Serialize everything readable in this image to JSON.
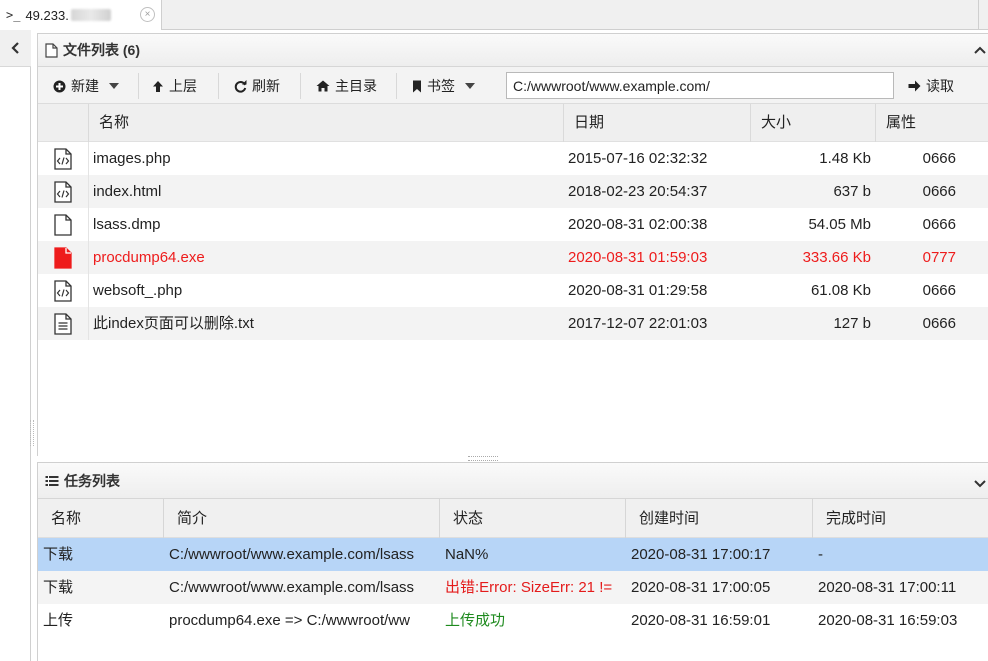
{
  "tab": {
    "prompt": ">_",
    "title": "49.233.",
    "close": "×"
  },
  "file_panel": {
    "title": "文件列表 (6)",
    "toolbar": {
      "new_label": "新建",
      "up_label": "上层",
      "refresh_label": "刷新",
      "home_label": "主目录",
      "bookmark_label": "书签",
      "path_value": "C:/wwwroot/www.example.com/",
      "read_label": "读取"
    },
    "columns": [
      "名称",
      "日期",
      "大小",
      "属性"
    ],
    "files": [
      {
        "icon": "code-file-icon",
        "name": "images.php",
        "date": "2015-07-16 02:32:32",
        "size": "1.48 Kb",
        "attr": "0666"
      },
      {
        "icon": "code-file-icon",
        "name": "index.html",
        "date": "2018-02-23 20:54:37",
        "size": "637 b",
        "attr": "0666"
      },
      {
        "icon": "blank-file-icon",
        "name": "lsass.dmp",
        "date": "2020-08-31 02:00:38",
        "size": "54.05 Mb",
        "attr": "0666"
      },
      {
        "icon": "executable-file-icon",
        "name": "procdump64.exe",
        "date": "2020-08-31 01:59:03",
        "size": "333.66 Kb",
        "attr": "0777",
        "highlight_color": "#ee1c1c"
      },
      {
        "icon": "code-file-icon",
        "name": "websoft_.php",
        "date": "2020-08-31 01:29:58",
        "size": "61.08 Kb",
        "attr": "0666"
      },
      {
        "icon": "text-file-icon",
        "name": "此index页面可以删除.txt",
        "date": "2017-12-07 22:01:03",
        "size": "127 b",
        "attr": "0666"
      }
    ]
  },
  "task_panel": {
    "title": "任务列表",
    "columns": [
      "名称",
      "简介",
      "状态",
      "创建时间",
      "完成时间"
    ],
    "tasks": [
      {
        "name": "下载",
        "desc": "C:/wwwroot/www.example.com/lsass",
        "status": "NaN%",
        "created": "2020-08-31 17:00:17",
        "done": "-",
        "selected": true
      },
      {
        "name": "下载",
        "desc": "C:/wwwroot/www.example.com/lsass",
        "status": "出错:Error: SizeErr: 21 !=",
        "created": "2020-08-31 17:00:05",
        "done": "2020-08-31 17:00:11",
        "status_color": "#e41b1b"
      },
      {
        "name": "上传",
        "desc": "procdump64.exe => C:/wwwroot/ww",
        "status": "上传成功",
        "created": "2020-08-31 16:59:01",
        "done": "2020-08-31 16:59:03",
        "status_color": "#1e8a1e"
      }
    ]
  }
}
